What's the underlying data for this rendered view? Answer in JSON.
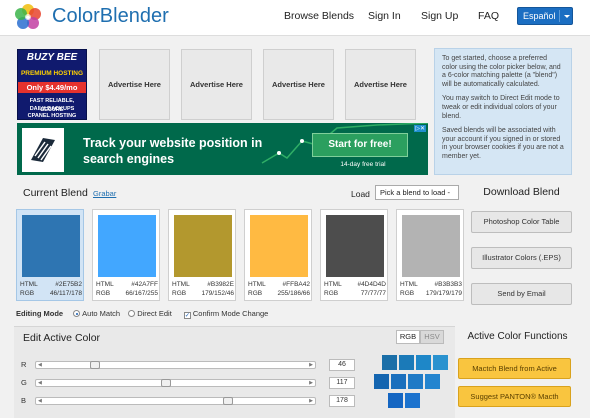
{
  "header": {
    "logo_text": "ColorBlender",
    "logo_icon": "flower-petals-icon",
    "nav": [
      "Browse Blends",
      "Sign In",
      "Sign Up",
      "FAQ"
    ],
    "language": "Español"
  },
  "ads": {
    "buzz": {
      "line1": "BUZY BEE",
      "line2": "PREMIUM HOSTING",
      "line3": "Only $4.49/mo",
      "line4": "FAST RELIABLE, SECURE",
      "line5": "DAILY BACKUPS",
      "line6": "CPANEL HOSTING"
    },
    "placeholders": [
      "Advertise Here",
      "Advertise Here",
      "Advertise Here",
      "Advertise Here"
    ],
    "google": {
      "text": "Track your website position in search engines",
      "button": "Start for free!",
      "trial": "14-day free trial"
    }
  },
  "info": {
    "p1": "To get started, choose a preferred color using the color picker below, and a 6-color matching palette (a \"blend\") will be automatically calculated.",
    "p2": "You may switch to Direct Edit mode to tweak or edit individual colors of your blend.",
    "p3": "Saved blends will be associated with your account if you signed in or stored in your browser cookies if you are not a member yet."
  },
  "current_blend": {
    "title": "Current Blend",
    "save_link": "Grabar",
    "load_label": "Load",
    "load_placeholder": "Pick a blend to load -",
    "swatches": [
      {
        "hex": "#2E75B2",
        "rgb": "46/117/178",
        "selected": true
      },
      {
        "hex": "#42A7FF",
        "rgb": "66/167/255",
        "selected": false
      },
      {
        "hex": "#B3982E",
        "rgb": "179/152/46",
        "selected": false
      },
      {
        "hex": "#FFBA42",
        "rgb": "255/186/66",
        "selected": false
      },
      {
        "hex": "#4D4D4D",
        "rgb": "77/77/77",
        "selected": false
      },
      {
        "hex": "#B3B3B3",
        "rgb": "179/179/179",
        "selected": false
      }
    ],
    "html_label": "HTML",
    "rgb_label": "RGB"
  },
  "editing_mode": {
    "label": "Editing Mode",
    "auto_match": "Auto Match",
    "direct_edit": "Direct Edit",
    "confirm": "Confirm Mode Change",
    "auto_match_selected": true,
    "confirm_checked": true
  },
  "download": {
    "title": "Download Blend",
    "buttons": [
      "Photoshop Color Table",
      "Illustrator Colors (.EPS)",
      "Send by Email"
    ]
  },
  "edit_active": {
    "title": "Edit Active Color",
    "mode_rgb": "RGB",
    "mode_hsv": "HSV",
    "sliders": [
      {
        "label": "R",
        "value": "46",
        "fraction": 0.18
      },
      {
        "label": "G",
        "value": "117",
        "fraction": 0.46
      },
      {
        "label": "B",
        "value": "178",
        "fraction": 0.7
      }
    ]
  },
  "tile_colors": [
    "#1b6fa8",
    "#1b7ab8",
    "#1e87c8",
    "#2a92cf",
    "#1465b0",
    "#1a6fbd",
    "#1f7ac6",
    "#2384cf",
    "#1566c2",
    "#1c73ce"
  ],
  "active_functions": {
    "title": "Active Color Functions",
    "buttons": [
      "Mactch Blend from Active",
      "Suggest PANTON® Macth"
    ]
  }
}
